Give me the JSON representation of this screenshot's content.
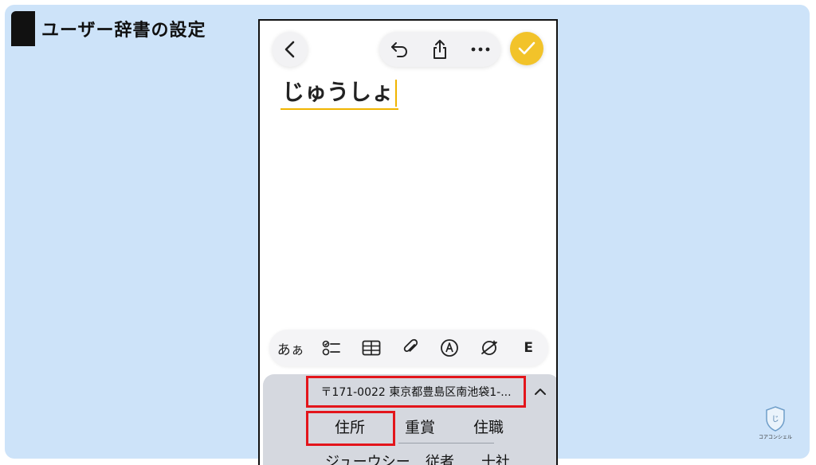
{
  "slide": {
    "title": "ユーザー辞書の設定"
  },
  "note": {
    "text": "じゅうしょ"
  },
  "toolbar": {
    "aa_label": "あぁ",
    "more_label": "E"
  },
  "keyboard": {
    "prediction": "〒171-0022 東京都豊島区南池袋1-...",
    "candidates": [
      "住所",
      "重賞",
      "住職"
    ],
    "second_row": [
      "ジューウシー",
      "従者",
      "十社"
    ]
  },
  "brand": {
    "logo_text": "コアコンシェル"
  },
  "colors": {
    "background": "#cde3f9",
    "highlight": "#e3151b",
    "done_button": "#f2c32a"
  }
}
